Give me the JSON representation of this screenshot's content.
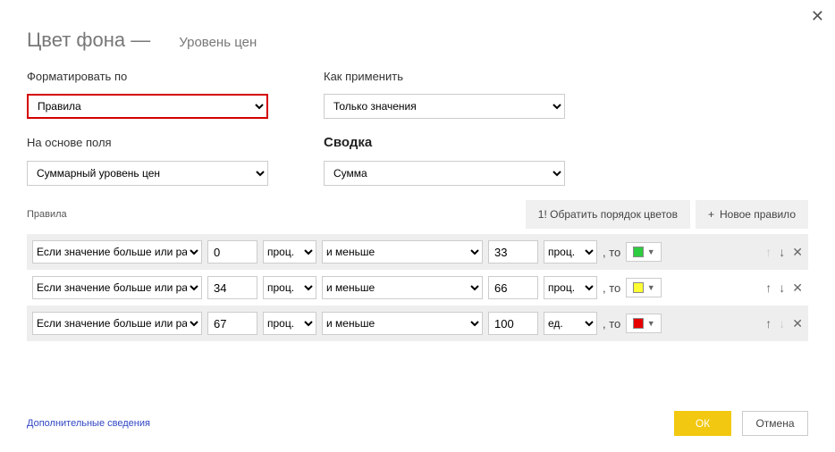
{
  "header": {
    "title": "Цвет фона —",
    "subtitle": "Уровень цен",
    "close": "✕"
  },
  "fields": {
    "format_by_label": "Форматировать по",
    "format_by_value": "Правила",
    "apply_label": "Как применить",
    "apply_value": "Только значения",
    "based_on_label": "На основе поля",
    "based_on_value": "Суммарный уровень цен",
    "summary_label": "Сводка",
    "summary_value": "Сумма"
  },
  "rules_header": {
    "label": "Правила",
    "reverse": "1! Обратить порядок цветов",
    "new_rule": "Новое правило"
  },
  "rule_text": {
    "then": ", то"
  },
  "rules": [
    {
      "cond": "Если значение больше или равно",
      "from": "0",
      "unit_from": "проц.",
      "and_less": "и меньше",
      "to": "33",
      "unit_to": "проц.",
      "color": "#2ecc40",
      "up_disabled": true,
      "down_disabled": false
    },
    {
      "cond": "Если значение больше или равно",
      "from": "34",
      "unit_from": "проц.",
      "and_less": "и меньше",
      "to": "66",
      "unit_to": "проц.",
      "color": "#ffff33",
      "up_disabled": false,
      "down_disabled": false
    },
    {
      "cond": "Если значение больше или равно",
      "from": "67",
      "unit_from": "проц.",
      "and_less": "и меньше",
      "to": "100",
      "unit_to": "ед.",
      "color": "#e60000",
      "up_disabled": false,
      "down_disabled": true
    }
  ],
  "footer": {
    "link": "Дополнительные сведения",
    "ok": "ОК",
    "cancel": "Отмена"
  }
}
